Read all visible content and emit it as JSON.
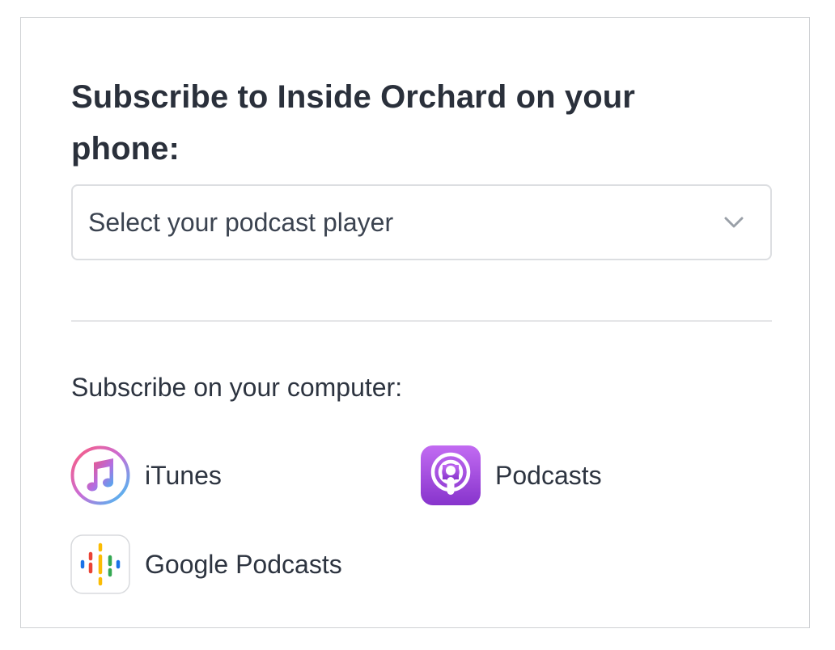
{
  "title": "Subscribe to Inside Orchard on your phone:",
  "player_select": {
    "placeholder": "Select your podcast player",
    "icon": "chevron-down-icon"
  },
  "computer_heading": "Subscribe on your computer:",
  "apps": [
    {
      "label": "iTunes",
      "icon": "itunes-icon"
    },
    {
      "label": "Podcasts",
      "icon": "apple-podcasts-icon"
    },
    {
      "label": "Google Podcasts",
      "icon": "google-podcasts-icon"
    }
  ],
  "colors": {
    "text": "#2d3440",
    "border": "#dcdee1",
    "podcasts_purple": "#a24fe0"
  }
}
